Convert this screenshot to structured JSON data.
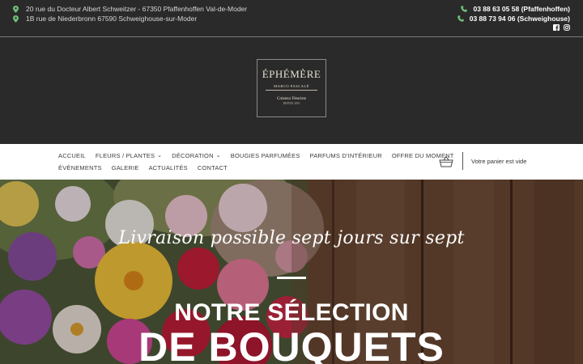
{
  "topbar": {
    "addresses": [
      "20 rue du Docteur Albert Schweitzer - 67350 Pfaffenhoffen Val-de-Moder",
      "1B rue de Niederbronn 67590 Schweighouse-sur-Moder"
    ],
    "phones": [
      "03 88 63 05 58 (Pfaffenhoffen)",
      "03 88 73 94 06 (Schweighouse)"
    ],
    "social_icons": [
      "facebook-icon",
      "instagram-icon"
    ],
    "pin_color": "#6fbf7a",
    "phone_icon_color": "#6fbf7a"
  },
  "logo": {
    "brand": "ÉPHÉMÈRE",
    "owner": "MARCO PASCALÉ",
    "role": "Créateur Fleuriste",
    "since": "DEPUIS 2010"
  },
  "nav": {
    "items_row1": [
      {
        "label": "ACCUEIL",
        "dropdown": false
      },
      {
        "label": "FLEURS / PLANTES",
        "dropdown": true
      },
      {
        "label": "DÉCORATION",
        "dropdown": true
      },
      {
        "label": "BOUGIES PARFUMÉES",
        "dropdown": false
      },
      {
        "label": "PARFUMS D'INTÉRIEUR",
        "dropdown": false
      },
      {
        "label": "OFFRE DU MOMENT",
        "dropdown": false
      }
    ],
    "items_row2": [
      {
        "label": "ÉVÈNEMENTS",
        "dropdown": false
      },
      {
        "label": "GALERIE",
        "dropdown": false
      },
      {
        "label": "ACTUALITÉS",
        "dropdown": false
      },
      {
        "label": "CONTACT",
        "dropdown": false
      }
    ],
    "cart_text": "Votre panier est vide"
  },
  "hero": {
    "tagline": "Livraison possible sept jours sur sept",
    "title_line1": "NOTRE SÉLECTION",
    "title_line2": "DE BOUQUETS"
  }
}
